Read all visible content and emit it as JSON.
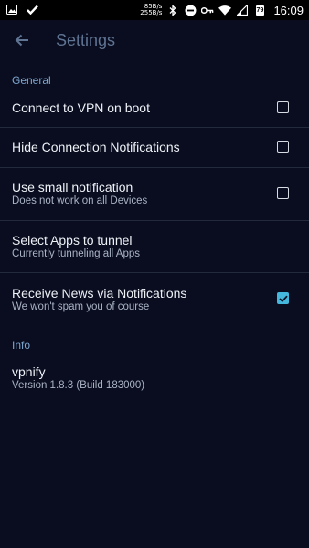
{
  "statusbar": {
    "net_up": "85B/s",
    "net_down": "255B/s",
    "battery": "79",
    "time": "16:09",
    "icons": [
      "image-icon",
      "check-icon",
      "bluetooth-icon",
      "dnd-icon",
      "key-icon",
      "wifi-icon",
      "signal-icon",
      "battery-icon"
    ]
  },
  "appbar": {
    "back_icon": "arrow-left-icon",
    "title": "Settings"
  },
  "sections": {
    "general": "General",
    "info": "Info"
  },
  "settings": {
    "vpn_boot": {
      "title": "Connect to VPN on boot",
      "checked": false
    },
    "hide_notifications": {
      "title": "Hide Connection Notifications",
      "checked": false
    },
    "small_notification": {
      "title": "Use small notification",
      "subtitle": "Does not work on all Devices",
      "checked": false
    },
    "select_apps": {
      "title": "Select Apps to tunnel",
      "subtitle": "Currently tunneling all Apps"
    },
    "news": {
      "title": "Receive News via Notifications",
      "subtitle": "We won't spam you of course",
      "checked": true
    }
  },
  "info": {
    "app_name": "vpnify",
    "version": "Version 1.8.3 (Build 183000)"
  },
  "colors": {
    "background": "#090d1f",
    "accent": "#45b7dc",
    "section_header": "#7ea6cf"
  }
}
